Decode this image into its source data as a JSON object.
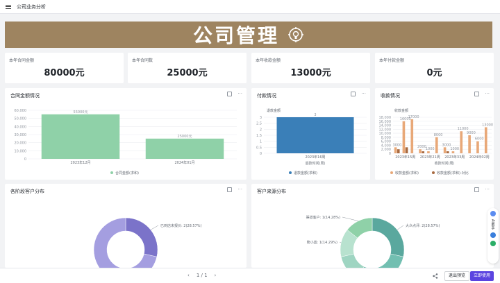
{
  "topbar": {
    "title": "公司业务分析"
  },
  "banner": {
    "title": "公司管理",
    "icon": "gear-head-icon"
  },
  "kpis": [
    {
      "label": "本年合同金额",
      "value": "80000元"
    },
    {
      "label": "本年合同数",
      "value": "25000元"
    },
    {
      "label": "本年收款金额",
      "value": "13000元"
    },
    {
      "label": "本年付款金额",
      "value": "0元"
    }
  ],
  "cards": {
    "contract_amount": {
      "title": "合同金额情况"
    },
    "payment": {
      "title": "付款情况"
    },
    "receipt": {
      "title": "收款情况"
    },
    "stage_customers": {
      "title": "各阶段客户分布"
    },
    "customer_source": {
      "title": "客户来源分布"
    }
  },
  "footer": {
    "page": "1 / 1",
    "prev": "‹",
    "next": "›",
    "exit_label": "退出预览",
    "use_label": "立即使用"
  },
  "side": {
    "label": "AI助手"
  },
  "colors": {
    "banner": "#9e8460",
    "green": "#8fd1a8",
    "blue": "#3a7fb8",
    "orange": "#e8a878",
    "brown": "#a86a40",
    "purple": "#7b73c9",
    "teal": "#5aa89e",
    "primary": "#5b44e0"
  },
  "chart_data": [
    {
      "type": "bar",
      "title": "合同金额情况",
      "categories": [
        "2023年12月",
        "2024年01月"
      ],
      "series": [
        {
          "name": "合同金额(求和)",
          "values": [
            55000,
            25000
          ]
        }
      ],
      "data_labels": [
        "55000元",
        "25000元"
      ],
      "ylim": [
        0,
        60000
      ],
      "yticks": [
        "0",
        "10,000",
        "20,000",
        "30,000",
        "40,000",
        "50,000",
        "60,000"
      ],
      "legend": "bottom"
    },
    {
      "type": "bar",
      "title": "付款情况",
      "ylabel": "退款金额",
      "xlabel": "退款时间(周)",
      "categories": [
        "2023年16周"
      ],
      "series": [
        {
          "name": "退款金额(求和)",
          "values": [
            3
          ]
        }
      ],
      "data_labels": [
        "3"
      ],
      "ylim": [
        0,
        3
      ],
      "yticks": [
        "0",
        "0.5",
        "1",
        "1.5",
        "2",
        "2.5",
        "3"
      ],
      "legend": "bottom"
    },
    {
      "type": "bar",
      "title": "收款情况",
      "ylabel": "收款金额",
      "xlabel": "收款时间(周)",
      "categories": [
        "2023年15周",
        "2023年21周",
        "2023年33周",
        "2024年02周"
      ],
      "series": [
        {
          "name": "收款金额(求和)",
          "values": [
            3000,
            16000,
            17000,
            2000,
            1000,
            8000,
            3000,
            1000,
            11000,
            9000,
            6000,
            13000
          ]
        },
        {
          "name": "收款金额(求和)-对比",
          "values": [
            2000,
            3000,
            0,
            1000,
            0,
            0,
            1000,
            0,
            0,
            0,
            0,
            0
          ]
        }
      ],
      "data_labels": [
        "3000",
        "16000",
        "17000",
        "2000",
        "1000",
        "8000",
        "3000",
        "1000",
        "11000",
        "9000",
        "6000",
        "13000"
      ],
      "ylim": [
        0,
        18000
      ],
      "yticks": [
        "0",
        "2,000",
        "4,000",
        "6,000",
        "8,000",
        "10,000",
        "12,000",
        "14,000",
        "16,000",
        "18,000"
      ],
      "legend": "bottom"
    },
    {
      "type": "pie",
      "title": "各阶段客户分布",
      "slices": [
        {
          "label": "已到店未报价: 2(28.57%)",
          "value": 2
        },
        {
          "label": "",
          "value": 5
        }
      ]
    },
    {
      "type": "pie",
      "title": "客户来源分布",
      "slices": [
        {
          "label": "大众点评: 2(28.57%)",
          "value": 2
        },
        {
          "label": "",
          "value": 2
        },
        {
          "label": "",
          "value": 1
        },
        {
          "label": "熊小蓝: 1(14.29%)",
          "value": 1
        },
        {
          "label": "渠道客户: 1(14.28%)",
          "value": 1
        }
      ]
    }
  ]
}
